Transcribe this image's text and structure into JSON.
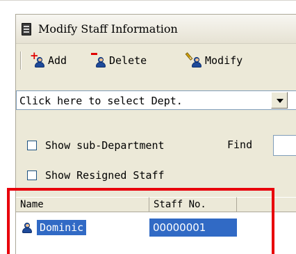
{
  "window": {
    "title": "Modify Staff Information"
  },
  "toolbar": {
    "add_label": "Add",
    "delete_label": "Delete",
    "modify_label": "Modify"
  },
  "department": {
    "selected_text": "Click here to select Dept."
  },
  "options": {
    "show_sub_department": "Show sub-Department",
    "show_sub_department_checked": false,
    "find_label": "Find",
    "show_resigned": "Show Resigned Staff",
    "show_resigned_checked": false
  },
  "table": {
    "columns": [
      "Name",
      "Staff No."
    ],
    "rows": [
      {
        "name": "Dominic",
        "staff_no": "00000001",
        "selected": true
      }
    ]
  },
  "colors": {
    "selection": "#316ac5",
    "highlight_box": "#e8000b",
    "panel_bg": "#ece9d8",
    "add_accent": "#e00000",
    "delete_accent": "#e00000"
  },
  "icons": {
    "window": "window-app-icon",
    "add": "add-staff-icon",
    "delete": "delete-staff-icon",
    "modify": "modify-staff-icon",
    "row": "staff-person-icon",
    "dropdown": "chevron-down-icon"
  }
}
